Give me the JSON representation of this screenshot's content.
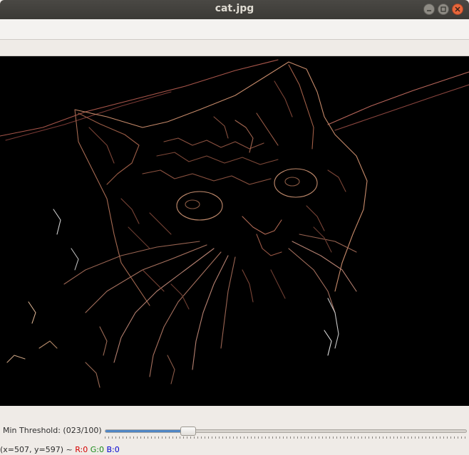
{
  "window": {
    "title": "cat.jpg",
    "controls": {
      "minimize": "minimize-icon",
      "maximize": "maximize-icon",
      "close": "close-icon"
    }
  },
  "image": {
    "description_icon": "edge-detected-image"
  },
  "trackbar": {
    "label": "Min Threshold: (023/100)",
    "value": 23,
    "max": 100,
    "fill_color": "#4f86c6"
  },
  "status": {
    "coords": "(x=507, y=597) ~",
    "r": "R:0",
    "g": "G:0",
    "b": "B:0"
  },
  "colors": {
    "titlebar": "#3b3a36",
    "close": "#e9673b",
    "background": "#efebe7"
  }
}
